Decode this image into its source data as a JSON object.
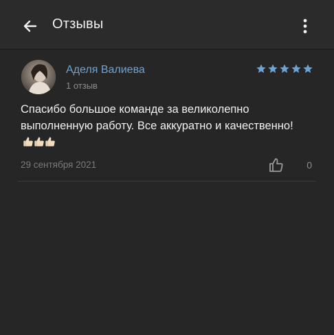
{
  "header": {
    "title": "Отзывы",
    "back_icon": "arrow-left-icon",
    "menu_icon": "more-vertical-icon"
  },
  "review": {
    "author": "Аделя Валиева",
    "review_count": "1 отзыв",
    "rating": 5,
    "rating_max": 5,
    "text": "Спасибо большое команде за великолепно выполненную работу. Все аккуратно и качественно!",
    "emoji_icons": [
      "thumbs-up-emoji",
      "thumbs-up-emoji",
      "thumbs-up-emoji"
    ],
    "date": "29 сентября 2021",
    "likes": "0",
    "like_icon": "thumbs-up-outline-icon"
  },
  "colors": {
    "background": "#262626",
    "appbar": "#2b2b2b",
    "author_name": "#6fa3d1",
    "star": "#6fa3d1",
    "secondary_text": "#8c8c8c"
  }
}
